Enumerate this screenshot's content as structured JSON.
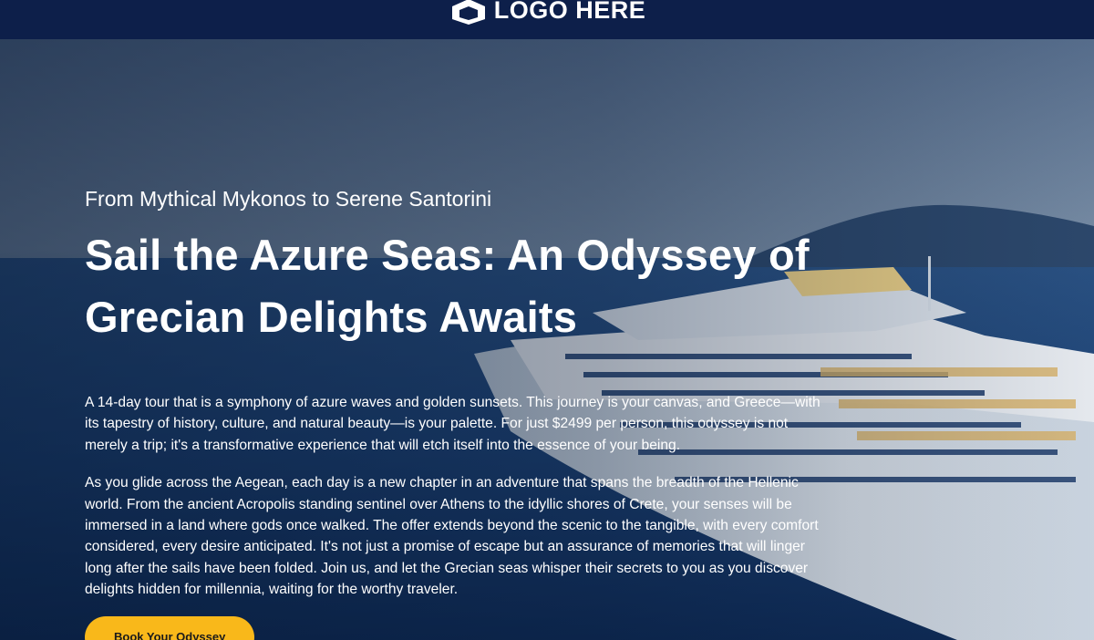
{
  "header": {
    "logo_text": "LOGO HERE",
    "background_color": "#0d1f4a"
  },
  "hero": {
    "subtitle": "From Mythical Mykonos to Serene Santorini",
    "title": "Sail the Azure Seas: An Odyssey of Grecian Delights Awaits",
    "paragraphs": [
      "A 14-day tour that is a symphony of azure waves and golden sunsets. This journey is your canvas, and Greece—with its tapestry of history, culture, and natural beauty—is your palette. For just $2499 per person, this odyssey is not merely a trip; it's a transformative experience that will etch itself into the essence of your being.",
      "As you glide across the Aegean, each day is a new chapter in an adventure that spans the breadth of the Hellenic world. From the ancient Acropolis standing sentinel over Athens to the idyllic shores of Crete, your senses will be immersed in a land where gods once walked. The offer extends beyond the scenic to the tangible, with every comfort considered, every desire anticipated. It's not just a promise of escape but an assurance of memories that will linger long after the sails have been folded. Join us, and let the Grecian seas whisper their secrets to you as you discover delights hidden for millennia, waiting for the worthy traveler."
    ],
    "cta_label": "Book Your Odyssey",
    "cta_color": "#f9b81a",
    "background_image": "cruise-ship-at-sea"
  }
}
